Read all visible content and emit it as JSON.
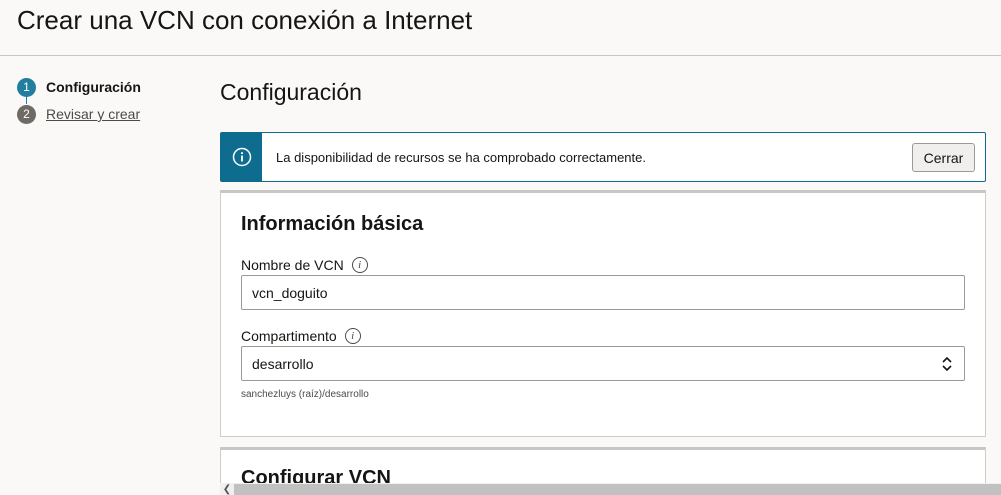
{
  "header": {
    "title": "Crear una VCN con conexión a Internet"
  },
  "steps": [
    {
      "number": "1",
      "label": "Configuración",
      "state": "active"
    },
    {
      "number": "2",
      "label": "Revisar y crear",
      "state": "inactive"
    }
  ],
  "main": {
    "heading": "Configuración",
    "banner": {
      "icon": "info-icon",
      "message": "La disponibilidad de recursos se ha comprobado correctamente.",
      "close_label": "Cerrar"
    },
    "basic_info": {
      "title": "Información básica",
      "vcn_name": {
        "label": "Nombre de VCN",
        "value": "vcn_doguito"
      },
      "compartment": {
        "label": "Compartimento",
        "value": "desarrollo",
        "helper": "sanchezluys (raíz)/desarrollo"
      }
    },
    "configure_vcn": {
      "title": "Configurar VCN"
    }
  },
  "colors": {
    "accent": "#227e9e",
    "banner_border": "#0e6d8f",
    "inactive_step": "#6f6a64",
    "page_background": "#fbf9f8"
  }
}
